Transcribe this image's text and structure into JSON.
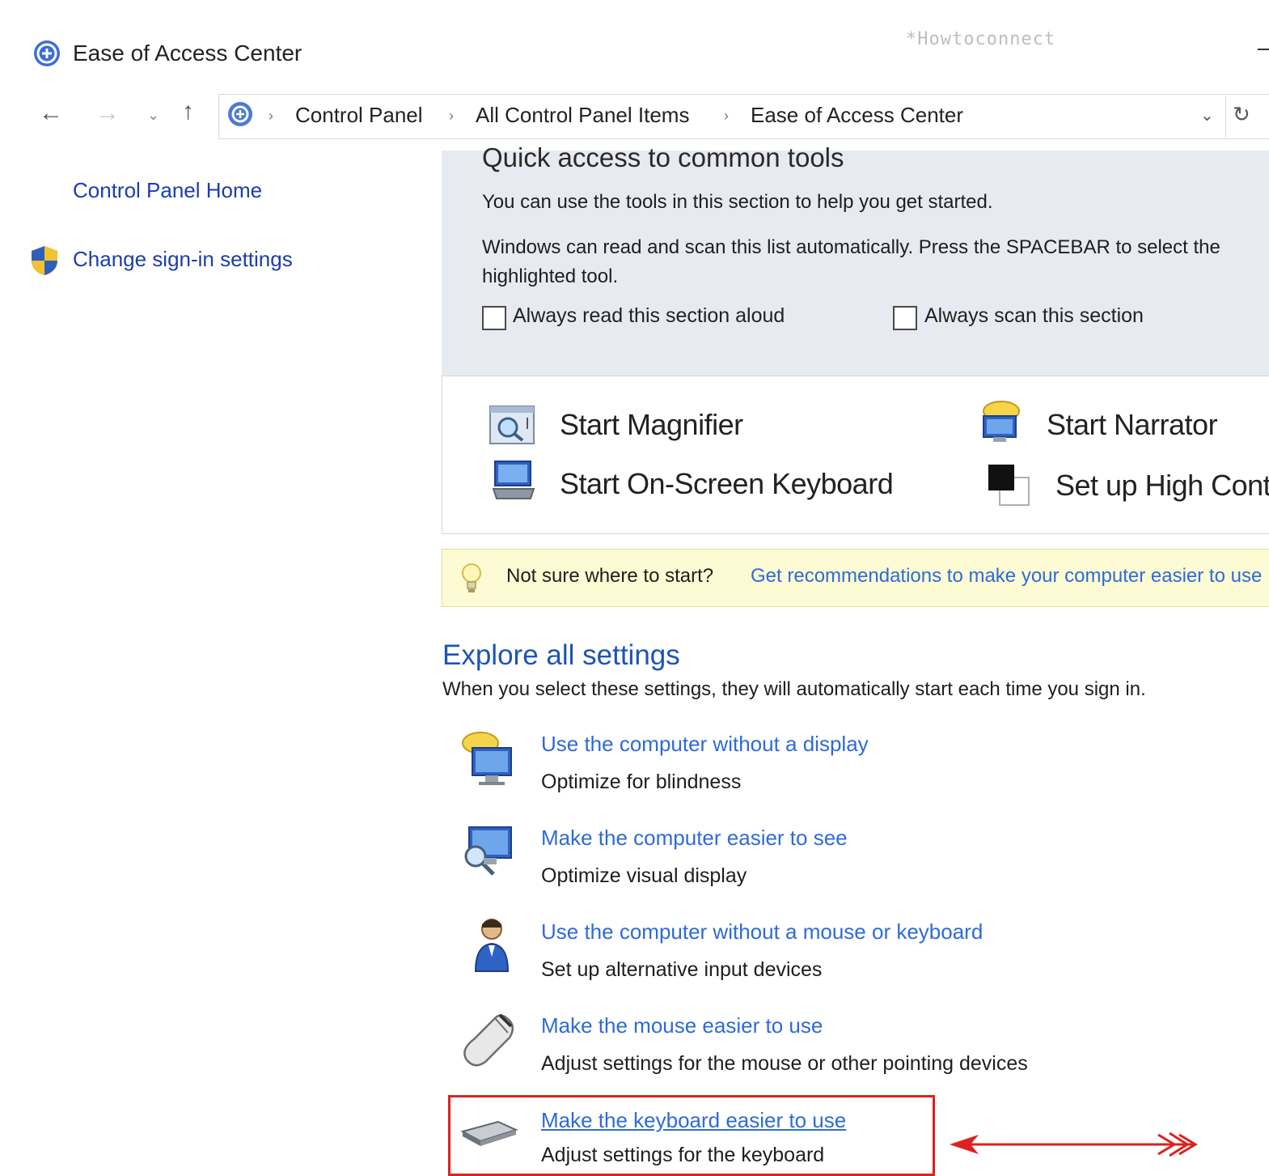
{
  "window": {
    "title": "Ease of Access Center",
    "watermark": "*Howtoconnect"
  },
  "nav": {
    "back_icon": "←",
    "forward_icon": "→",
    "recent_icon": "⌄",
    "up_icon": "↑",
    "breadcrumb": [
      "Control Panel",
      "All Control Panel Items",
      "Ease of Access Center"
    ],
    "breadcrumb_separator": "›",
    "dropdown_icon": "⌄",
    "refresh_icon": "↻"
  },
  "sidebar": {
    "home": "Control Panel Home",
    "signin": "Change sign-in settings"
  },
  "quick_access": {
    "heading": "Quick access to common tools",
    "desc1": "You can use the tools in this section to help you get started.",
    "desc2": "Windows can read and scan this list automatically.  Press the SPACEBAR to select the highlighted tool.",
    "checkbox1": "Always read this section aloud",
    "checkbox2": "Always scan this section",
    "tools": [
      "Start Magnifier",
      "Start Narrator",
      "Start On-Screen Keyboard",
      "Set up High Contrast"
    ]
  },
  "tip": {
    "static": "Not sure where to start?",
    "link": "Get recommendations to make your computer easier to use"
  },
  "explore": {
    "heading": "Explore all settings",
    "desc": "When you select these settings, they will automatically start each time you sign in.",
    "items": [
      {
        "link": "Use the computer without a display",
        "sub": "Optimize for blindness"
      },
      {
        "link": "Make the computer easier to see",
        "sub": "Optimize visual display"
      },
      {
        "link": "Use the computer without a mouse or keyboard",
        "sub": "Set up alternative input devices"
      },
      {
        "link": "Make the mouse easier to use",
        "sub": "Adjust settings for the mouse or other pointing devices"
      },
      {
        "link": "Make the keyboard easier to use",
        "sub": "Adjust settings for the keyboard"
      }
    ]
  },
  "colors": {
    "link": "#2e6bd6",
    "heading_blue": "#1c55b3",
    "panel_bg": "#e7eaf0",
    "tip_bg": "#fdfbd4",
    "highlight": "#e02020"
  }
}
